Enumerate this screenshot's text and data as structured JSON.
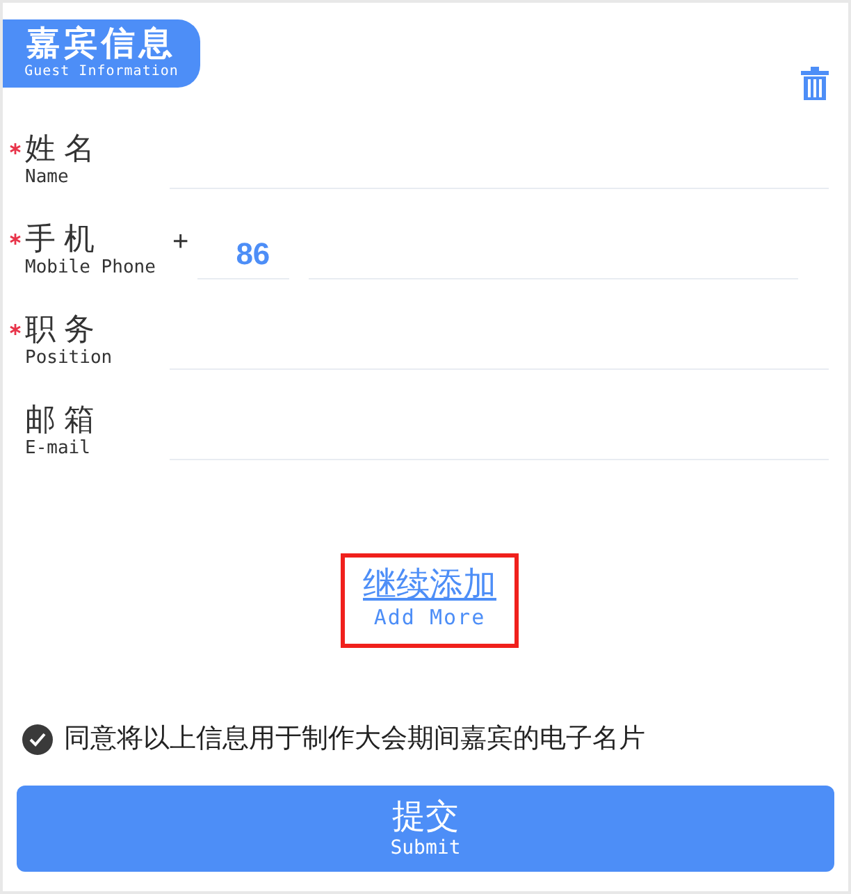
{
  "header": {
    "title": "嘉宾信息",
    "subtitle": "Guest Information"
  },
  "fields": [
    {
      "kind": "text",
      "label": "姓 名",
      "label_en": "Name",
      "required": true
    },
    {
      "kind": "phone",
      "label": "手 机",
      "label_en": "Mobile Phone",
      "required": true,
      "prefix": "+",
      "code": "86"
    },
    {
      "kind": "text",
      "label": "职 务",
      "label_en": "Position",
      "required": true
    },
    {
      "kind": "text",
      "label": "邮 箱",
      "label_en": "E-mail",
      "required": false
    }
  ],
  "add_more": {
    "label": "继续添加",
    "label_en": "Add More",
    "highlighted": true
  },
  "consent": {
    "text": "同意将以上信息用于制作大会期间嘉宾的电子名片",
    "checked": true
  },
  "submit": {
    "label": "提交",
    "label_en": "Submit"
  }
}
